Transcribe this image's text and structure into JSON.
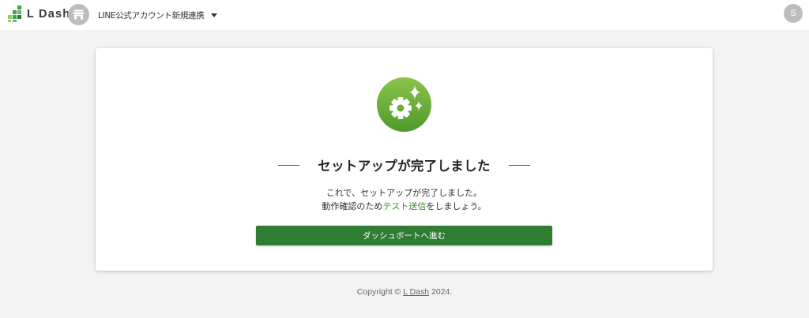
{
  "header": {
    "logo_text": "L Dash",
    "account_name": "LINE公式アカウント新規連携",
    "user_initial": "S"
  },
  "main": {
    "title": "セットアップが完了しました",
    "desc_line1": "これで、セットアップが完了しました。",
    "desc_line2_prefix": "動作確認のため",
    "test_link_label": "テスト送信",
    "desc_line2_suffix": "をしましょう。",
    "dashboard_button_label": "ダッシュボートへ進む"
  },
  "footer": {
    "copyright_prefix": "Copyright © ",
    "brand_link": "L Dash",
    "copyright_suffix": " 2024."
  },
  "colors": {
    "brand_green": "#2e7d32",
    "link_green": "#3d8b2e",
    "icon_green_light": "#8bc34a",
    "icon_green_dark": "#4e9a2b"
  },
  "icons": {
    "logo": "green-dots-logo-icon",
    "shop": "storefront-icon",
    "caret": "caret-down-icon",
    "hero": "gear-sparkle-icon"
  }
}
